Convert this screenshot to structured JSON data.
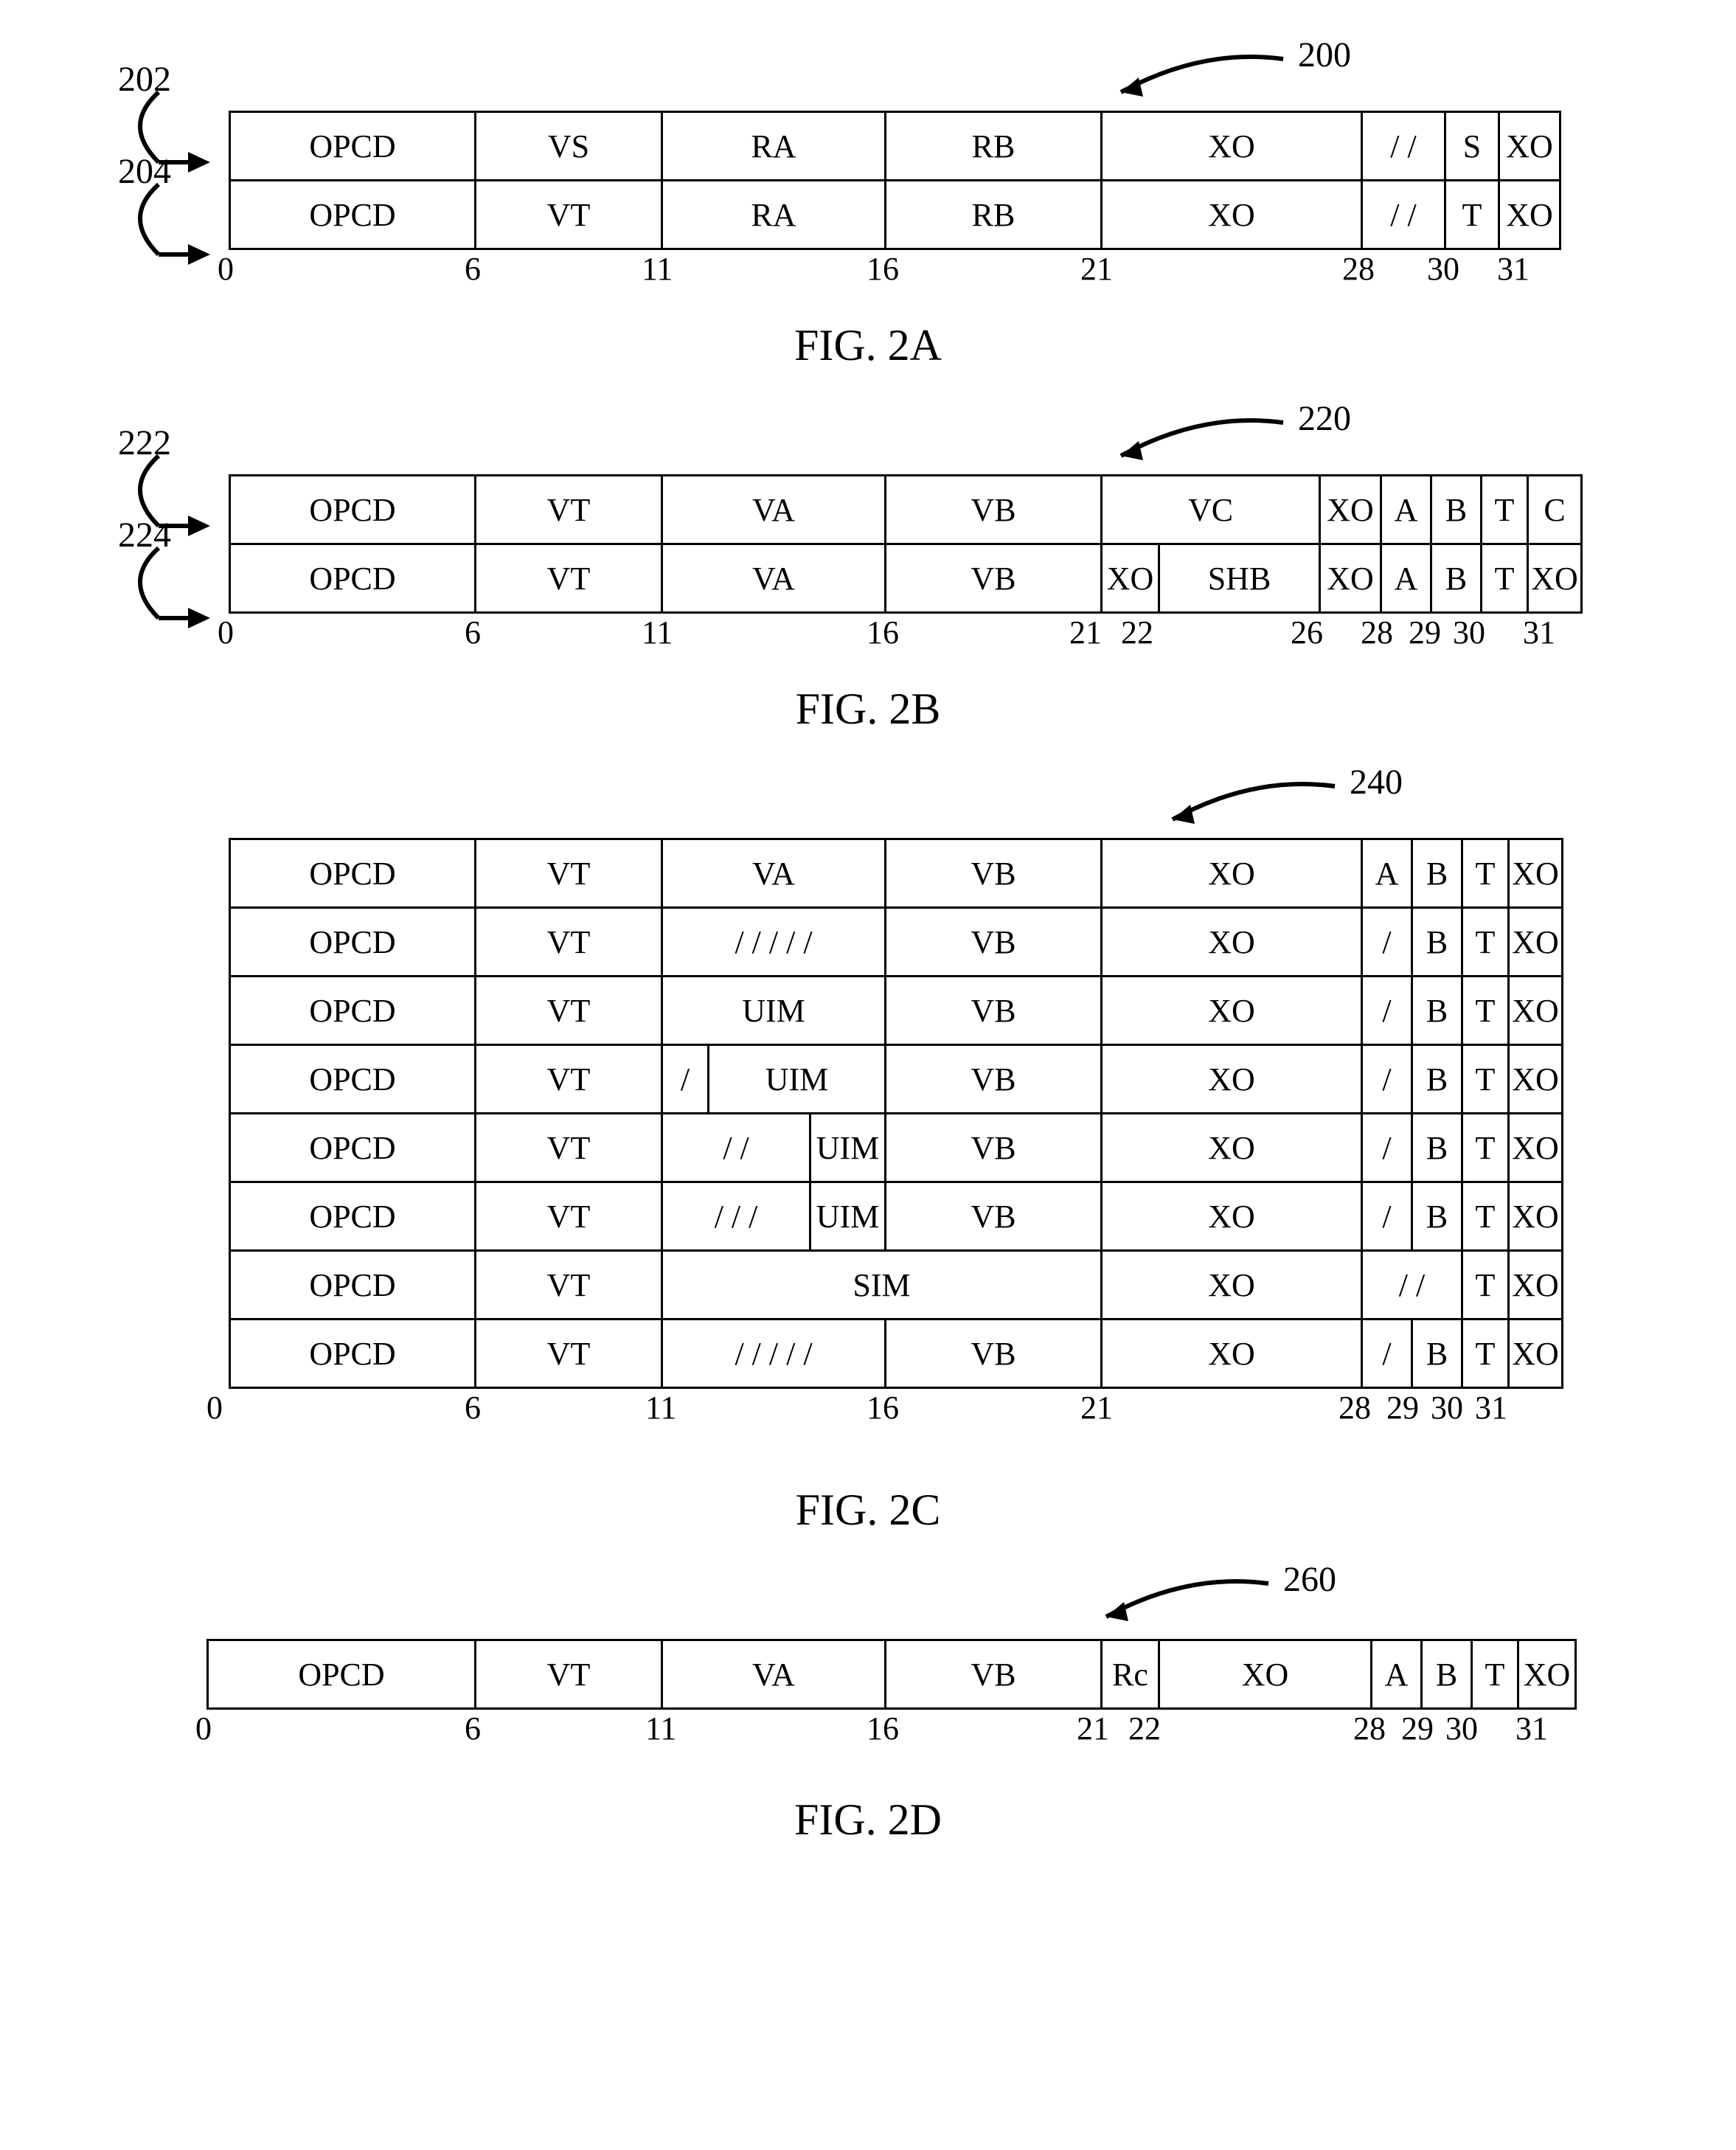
{
  "figA": {
    "callout": "200",
    "left_labels": [
      "202",
      "204"
    ],
    "rows": [
      [
        "OPCD",
        "VS",
        "RA",
        "RB",
        "XO",
        "/ /",
        "S",
        "XO"
      ],
      [
        "OPCD",
        "VT",
        "RA",
        "RB",
        "XO",
        "/ /",
        "T",
        "XO"
      ]
    ],
    "bits": [
      "0",
      "6",
      "11",
      "16",
      "21",
      "28",
      "30",
      "31"
    ],
    "caption": "FIG. 2A"
  },
  "figB": {
    "callout": "220",
    "left_labels": [
      "222",
      "224"
    ],
    "row1": [
      "OPCD",
      "VT",
      "VA",
      "VB",
      "VC",
      "XO",
      "A",
      "B",
      "T",
      "C"
    ],
    "row2": [
      "OPCD",
      "VT",
      "VA",
      "VB",
      "XO",
      "SHB",
      "XO",
      "A",
      "B",
      "T",
      "XO"
    ],
    "bits": [
      "0",
      "6",
      "11",
      "16",
      "21",
      "22",
      "26",
      "28",
      "29",
      "30",
      "31"
    ],
    "caption": "FIG. 2B"
  },
  "figC": {
    "callout": "240",
    "rows": {
      "r1": [
        "OPCD",
        "VT",
        "VA",
        "VB",
        "XO",
        "A",
        "B",
        "T",
        "XO"
      ],
      "r2": [
        "OPCD",
        "VT",
        "/ / / / /",
        "VB",
        "XO",
        "/",
        "B",
        "T",
        "XO"
      ],
      "r3": [
        "OPCD",
        "VT",
        "UIM",
        "VB",
        "XO",
        "/",
        "B",
        "T",
        "XO"
      ],
      "r4": [
        "OPCD",
        "VT",
        "/",
        "UIM",
        "VB",
        "XO",
        "/",
        "B",
        "T",
        "XO"
      ],
      "r5": [
        "OPCD",
        "VT",
        "/ /",
        "UIM",
        "VB",
        "XO",
        "/",
        "B",
        "T",
        "XO"
      ],
      "r6": [
        "OPCD",
        "VT",
        "/ / /",
        "UIM",
        "VB",
        "XO",
        "/",
        "B",
        "T",
        "XO"
      ],
      "r7": [
        "OPCD",
        "VT",
        "SIM",
        "XO",
        "/ /",
        "T",
        "XO"
      ],
      "r8": [
        "OPCD",
        "VT",
        "/ / / / /",
        "VB",
        "XO",
        "/",
        "B",
        "T",
        "XO"
      ]
    },
    "bits": [
      "0",
      "6",
      "11",
      "16",
      "21",
      "28",
      "29",
      "30",
      "31"
    ],
    "caption": "FIG. 2C"
  },
  "figD": {
    "callout": "260",
    "row": [
      "OPCD",
      "VT",
      "VA",
      "VB",
      "Rc",
      "XO",
      "A",
      "B",
      "T",
      "XO"
    ],
    "bits": [
      "0",
      "6",
      "11",
      "16",
      "21",
      "22",
      "28",
      "29",
      "30",
      "31"
    ],
    "caption": "FIG. 2D"
  }
}
